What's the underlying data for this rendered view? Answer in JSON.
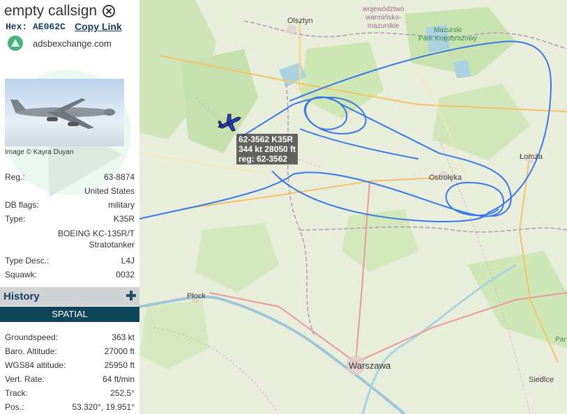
{
  "header": {
    "callsign": "empty callsign",
    "hex_label": "Hex: AE062C",
    "copy_link": "Copy Link",
    "source": "adsbexchange.com"
  },
  "photo": {
    "credit": "Image © Kayra Duyan"
  },
  "details": {
    "reg_label": "Reg.:",
    "reg_value": "63-8874",
    "country": "United States",
    "dbflags_label": "DB flags:",
    "dbflags_value": "military",
    "type_label": "Type:",
    "type_value": "K35R",
    "type_full": "BOEING KC-135R/T Stratotanker",
    "typedesc_label": "Type Desc.:",
    "typedesc_value": "L4J",
    "squawk_label": "Squawk:",
    "squawk_value": "0032"
  },
  "history": {
    "label": "History"
  },
  "spatial": {
    "label": "SPATIAL",
    "groundspeed_label": "Groundspeed:",
    "groundspeed_value": "363 kt",
    "baro_label": "Baro. Altitude:",
    "baro_value": "27000 ft",
    "wgs_label": "WGS84 altitude:",
    "wgs_value": "25950 ft",
    "vrate_label": "Vert. Rate:",
    "vrate_value": "64 ft/min",
    "track_label": "Track:",
    "track_value": "252.5°",
    "pos_label": "Pos.:",
    "pos_value": "53.320°, 19.951°"
  },
  "map": {
    "cities": {
      "olsztyn": "Olsztyn",
      "lomza": "Łomża",
      "ostroleka": "Ostrołęka",
      "plock": "Płock",
      "warszawa": "Warszawa",
      "siedlce": "Siedlce"
    },
    "region": {
      "line1": "województwo",
      "line2": "warmińsko-",
      "line3": "mazurskie"
    },
    "park": {
      "line1": "Mazurski",
      "line2": "Park Krajobrazowy",
      "edge": "Par"
    },
    "aircraft_tag": {
      "line1": "62-3562 K35R",
      "line2": "344 kt  28050 ft",
      "line3": "reg: 62-3562"
    },
    "track_color": "#3b78e7",
    "aircraft_color": "#2a3fd6"
  }
}
